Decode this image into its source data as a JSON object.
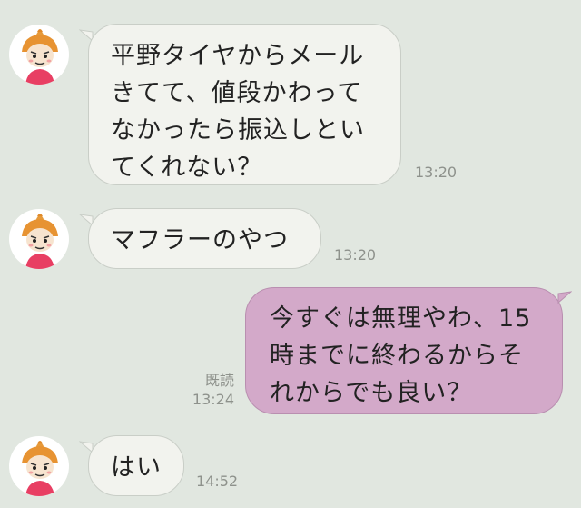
{
  "messages": [
    {
      "direction": "incoming",
      "lines": [
        "平野タイヤからメール",
        "きてて、値段かわって",
        "なかったら振込しとい",
        "てくれない？"
      ],
      "time": "13:20"
    },
    {
      "direction": "incoming",
      "lines": [
        "マフラーのやつ"
      ],
      "time": "13:20"
    },
    {
      "direction": "outgoing",
      "lines": [
        "今すぐは無理やわ、15",
        "時までに終わるからそ",
        "れからでも良い？"
      ],
      "read": "既読",
      "time": "13:24"
    },
    {
      "direction": "incoming",
      "lines": [
        "はい"
      ],
      "time": "14:52"
    }
  ],
  "colors": {
    "background": "#e1e7e0",
    "incoming_bubble": "#f2f3ee",
    "outgoing_bubble": "#d3a9c9",
    "timestamp": "#8e928c"
  },
  "icons": {
    "avatar": "little-my-avatar-icon"
  }
}
